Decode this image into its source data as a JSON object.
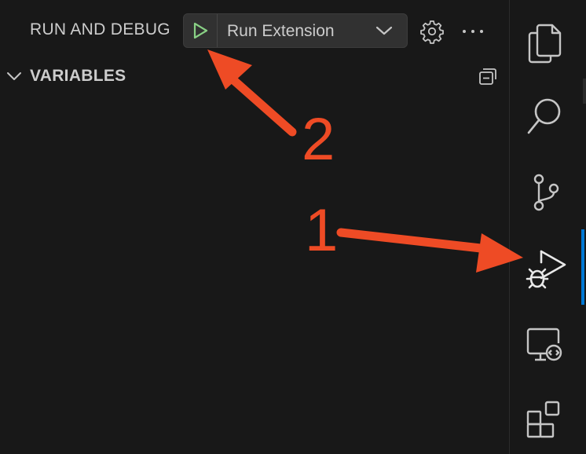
{
  "panel": {
    "title": "RUN AND DEBUG",
    "launch_config": "Run Extension",
    "variables_section": "VARIABLES"
  },
  "icons": {
    "start": "play-icon",
    "dropdown": "chevron-down-icon",
    "settings": "gear-icon",
    "more": "ellipsis-icon",
    "section_toggle": "chevron-down-icon",
    "collapse_all": "collapse-all-icon"
  },
  "activity_bar": {
    "items": [
      {
        "name": "explorer",
        "icon": "files-icon"
      },
      {
        "name": "search",
        "icon": "search-icon"
      },
      {
        "name": "source-control",
        "icon": "source-control-icon"
      },
      {
        "name": "run-and-debug",
        "icon": "run-debug-icon",
        "active": true
      },
      {
        "name": "remote-explorer",
        "icon": "remote-explorer-icon"
      },
      {
        "name": "extensions",
        "icon": "extensions-icon"
      }
    ]
  },
  "annotations": {
    "label_1": "1",
    "label_2": "2"
  },
  "colors": {
    "background": "#181818",
    "text": "#cccccc",
    "icon": "#c5c5c5",
    "play_green": "#89d185",
    "accent": "#0078d4",
    "annotation": "#ee4b25"
  }
}
